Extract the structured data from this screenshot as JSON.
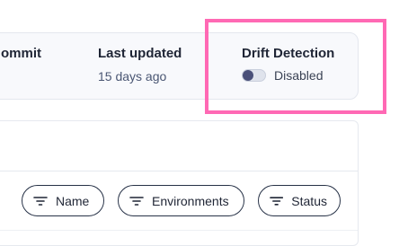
{
  "info": {
    "commit_label": "ommit",
    "updated_label": "Last updated",
    "updated_value": "15 days ago",
    "drift_label": "Drift Detection",
    "drift_status": "Disabled",
    "drift_enabled": false
  },
  "filters": [
    {
      "label": "Name",
      "icon": "filter-icon"
    },
    {
      "label": "Environments",
      "icon": "filter-icon"
    },
    {
      "label": "Status",
      "icon": "filter-icon"
    }
  ],
  "colors": {
    "highlight": "#ff69b4",
    "toggle_knob": "#4a5079",
    "text_primary": "#1f2535",
    "text_secondary": "#4a5673"
  }
}
